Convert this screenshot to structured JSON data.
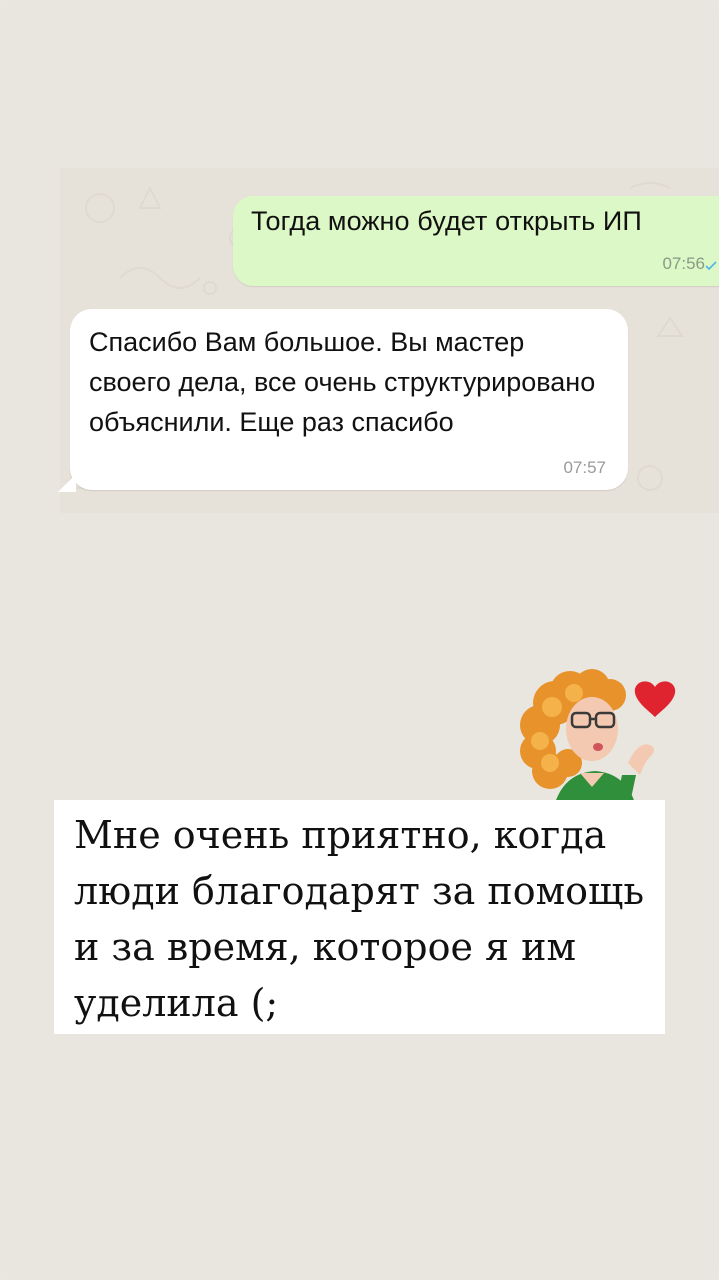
{
  "chat": {
    "outgoing": {
      "text": "Тогда можно будет открыть ИП",
      "time": "07:56"
    },
    "incoming": {
      "text": "Спасибо Вам большое. Вы мастер своего дела, все очень структурировано объяснили. Еще раз спасибо",
      "time": "07:57"
    }
  },
  "caption": {
    "text": "Мне очень приятно, когда люди благодарят за помощь и за время, которое я им уделила (;"
  },
  "sticker": {
    "icon": "avatar-heart-sticker"
  },
  "colors": {
    "outgoing_bubble": "#dcf8c6",
    "incoming_bubble": "#ffffff",
    "chat_background": "#e7e2d9",
    "story_background": "#e9e6df"
  }
}
